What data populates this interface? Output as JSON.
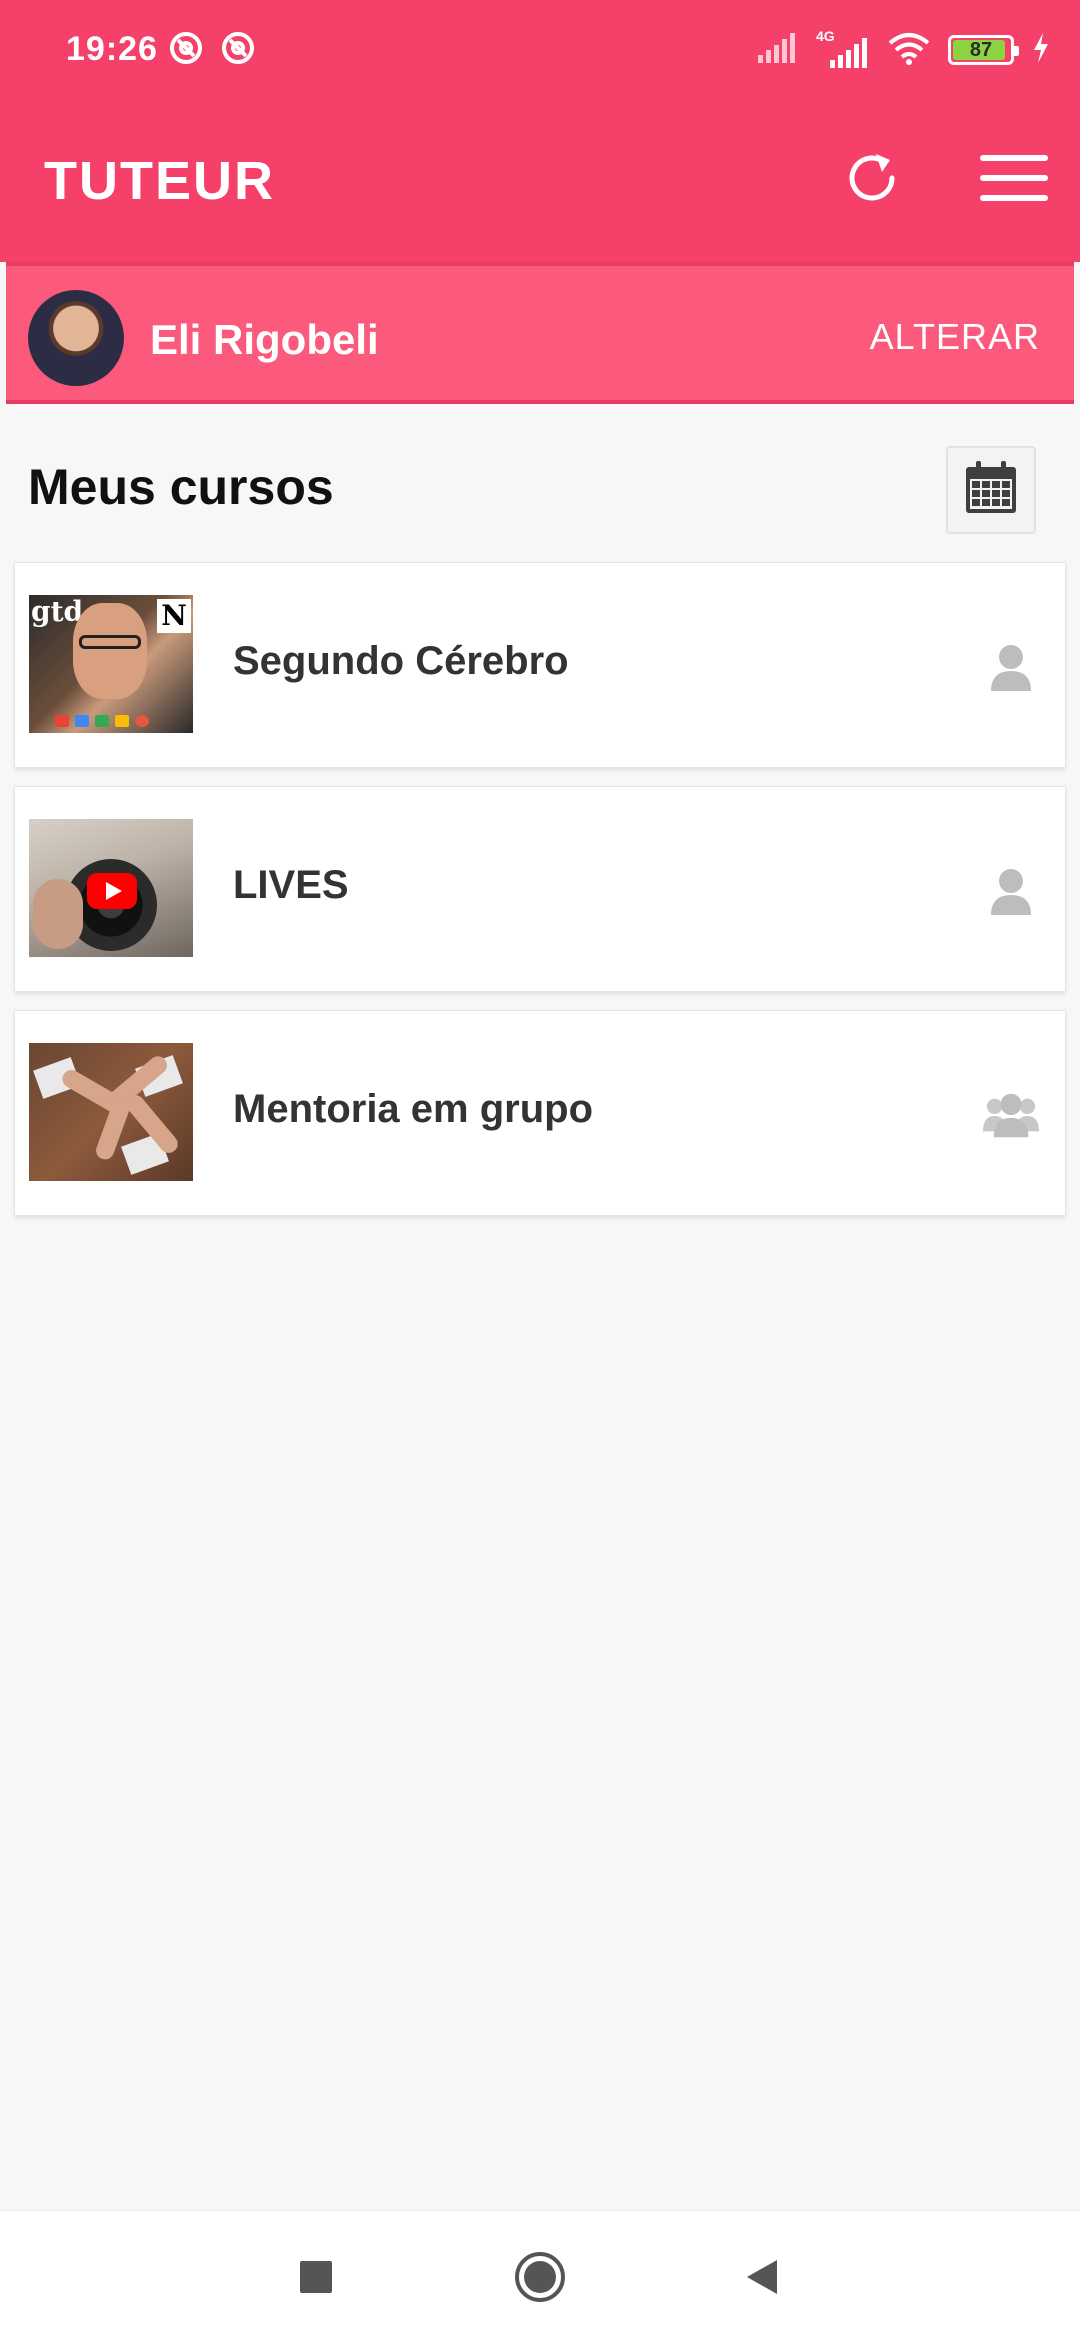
{
  "status_bar": {
    "time": "19:26",
    "network": "4G",
    "battery": "87",
    "battery_level": 0.87
  },
  "app_bar": {
    "title": "TUTEUR",
    "refresh_icon": "refresh-icon",
    "menu_icon": "hamburger-menu-icon"
  },
  "profile": {
    "name": "Eli Rigobeli",
    "change_label": "ALTERAR"
  },
  "section": {
    "title": "Meus cursos",
    "calendar_icon": "calendar-icon"
  },
  "courses": [
    {
      "title": "Segundo Cérebro",
      "type_icon": "single-user-icon"
    },
    {
      "title": "LIVES",
      "type_icon": "single-user-icon"
    },
    {
      "title": "Mentoria em grupo",
      "type_icon": "group-users-icon"
    }
  ],
  "colors": {
    "primary": "#f5406a",
    "profile_bar": "#fb5a7d",
    "background": "#f7f7f8",
    "card": "#ffffff",
    "icon_gray": "#bdbdbd"
  },
  "nav": {
    "recent_icon": "square-recents-icon",
    "home_icon": "circle-home-icon",
    "back_icon": "triangle-back-icon"
  }
}
